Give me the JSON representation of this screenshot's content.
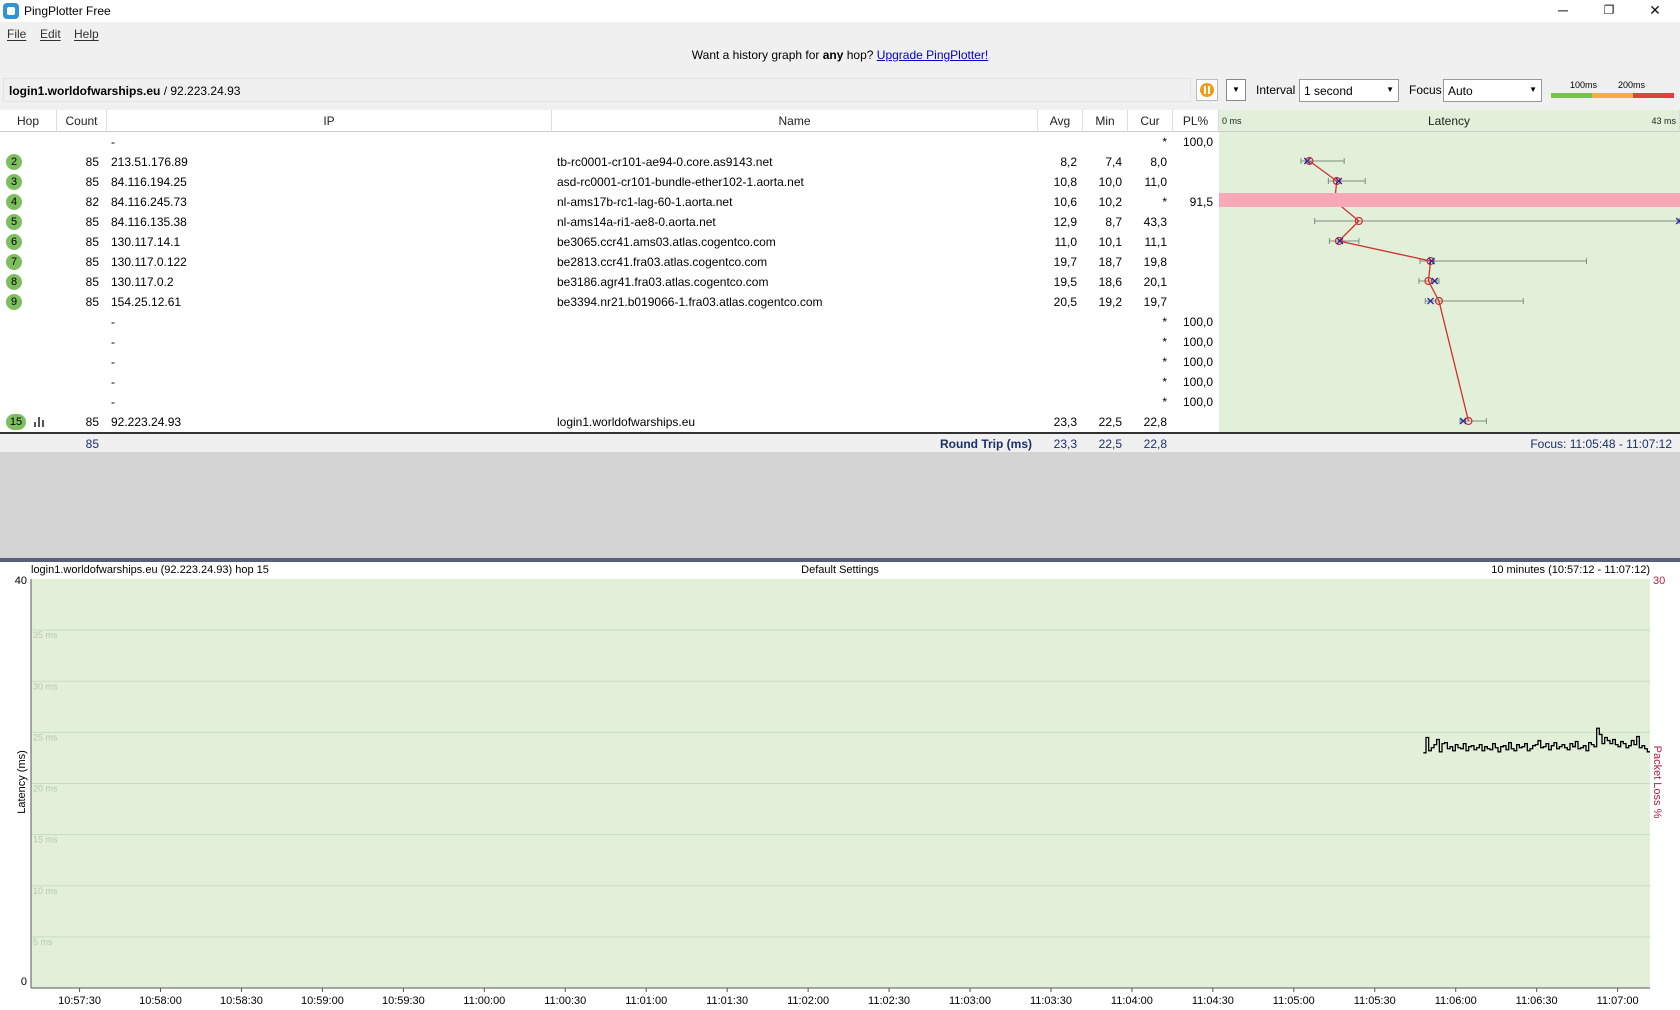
{
  "window": {
    "title": "PingPlotter Free",
    "minimize": "─",
    "maximize": "❐",
    "close": "✕"
  },
  "menu": [
    {
      "label": "File"
    },
    {
      "label": "Edit"
    },
    {
      "label": "Help"
    }
  ],
  "banner": {
    "prefix": "Want a history graph for ",
    "bold": "any",
    "middle": " hop? ",
    "link": "Upgrade PingPlotter!"
  },
  "target": {
    "host": "login1.worldofwarships.eu",
    "ip": " / 92.223.24.93"
  },
  "controls": {
    "interval_label": "Interval",
    "interval_value": "1 second",
    "focus_label": "Focus",
    "focus_value": "Auto",
    "scale_100": "100ms",
    "scale_200": "200ms"
  },
  "colors": {
    "good": "#78c050",
    "warn": "#f0b040",
    "bad": "#e04040",
    "lossRow": "#f7a8b8",
    "latencyBg": "#e2f0d9",
    "line": "#d03030"
  },
  "table": {
    "columns": [
      "Hop",
      "Count",
      "IP",
      "Name",
      "Avg",
      "Min",
      "Cur",
      "PL%",
      "Latency"
    ],
    "latency_min_label": "0 ms",
    "latency_max_label": "43 ms",
    "rows": [
      {
        "hop": "",
        "count": "",
        "ip": "-",
        "name": "",
        "avg": "",
        "min": "",
        "cur": "*",
        "pl": "100,0"
      },
      {
        "hop": "2",
        "count": "85",
        "ip": "213.51.176.89",
        "name": "tb-rc0001-cr101-ae94-0.core.as9143.net",
        "avg": "8,2",
        "min": "7,4",
        "cur": "8,0",
        "pl": ""
      },
      {
        "hop": "3",
        "count": "85",
        "ip": "84.116.194.25",
        "name": "asd-rc0001-cr101-bundle-ether102-1.aorta.net",
        "avg": "10,8",
        "min": "10,0",
        "cur": "11,0",
        "pl": ""
      },
      {
        "hop": "4",
        "count": "82",
        "ip": "84.116.245.73",
        "name": "nl-ams17b-rc1-lag-60-1.aorta.net",
        "avg": "10,6",
        "min": "10,2",
        "cur": "*",
        "pl": "91,5"
      },
      {
        "hop": "5",
        "count": "85",
        "ip": "84.116.135.38",
        "name": "nl-ams14a-ri1-ae8-0.aorta.net",
        "avg": "12,9",
        "min": "8,7",
        "cur": "43,3",
        "pl": ""
      },
      {
        "hop": "6",
        "count": "85",
        "ip": "130.117.14.1",
        "name": "be3065.ccr41.ams03.atlas.cogentco.com",
        "avg": "11,0",
        "min": "10,1",
        "cur": "11,1",
        "pl": ""
      },
      {
        "hop": "7",
        "count": "85",
        "ip": "130.117.0.122",
        "name": "be2813.ccr41.fra03.atlas.cogentco.com",
        "avg": "19,7",
        "min": "18,7",
        "cur": "19,8",
        "pl": ""
      },
      {
        "hop": "8",
        "count": "85",
        "ip": "130.117.0.2",
        "name": "be3186.agr41.fra03.atlas.cogentco.com",
        "avg": "19,5",
        "min": "18,6",
        "cur": "20,1",
        "pl": ""
      },
      {
        "hop": "9",
        "count": "85",
        "ip": "154.25.12.61",
        "name": "be3394.nr21.b019066-1.fra03.atlas.cogentco.com",
        "avg": "20,5",
        "min": "19,2",
        "cur": "19,7",
        "pl": ""
      },
      {
        "hop": "",
        "count": "",
        "ip": "-",
        "name": "",
        "avg": "",
        "min": "",
        "cur": "*",
        "pl": "100,0"
      },
      {
        "hop": "",
        "count": "",
        "ip": "-",
        "name": "",
        "avg": "",
        "min": "",
        "cur": "*",
        "pl": "100,0"
      },
      {
        "hop": "",
        "count": "",
        "ip": "-",
        "name": "",
        "avg": "",
        "min": "",
        "cur": "*",
        "pl": "100,0"
      },
      {
        "hop": "",
        "count": "",
        "ip": "-",
        "name": "",
        "avg": "",
        "min": "",
        "cur": "*",
        "pl": "100,0"
      },
      {
        "hop": "",
        "count": "",
        "ip": "-",
        "name": "",
        "avg": "",
        "min": "",
        "cur": "*",
        "pl": "100,0"
      },
      {
        "hop": "15",
        "count": "85",
        "ip": "92.223.24.93",
        "name": "login1.worldofwarships.eu",
        "avg": "23,3",
        "min": "22,5",
        "cur": "22,8",
        "pl": ""
      }
    ],
    "round_trip": {
      "count": "85",
      "label": "Round Trip (ms)",
      "avg": "23,3",
      "min": "22,5",
      "cur": "22,8",
      "focus": "Focus: 11:05:48 - 11:07:12"
    }
  },
  "latency_graph": {
    "range_ms": [
      0,
      43
    ],
    "points": [
      {
        "hop": "2",
        "avg": 8.2,
        "cur": 8.0,
        "min": 7.4,
        "max": 11.5,
        "rowIndex": 1
      },
      {
        "hop": "3",
        "avg": 10.8,
        "cur": 11.0,
        "min": 10.0,
        "max": 13.5,
        "rowIndex": 2
      },
      {
        "hop": "4",
        "avg": 10.6,
        "cur": null,
        "min": 10.2,
        "max": 10.8,
        "rowIndex": 3
      },
      {
        "hop": "5",
        "avg": 12.9,
        "cur": 43.3,
        "min": 8.7,
        "max": 43.3,
        "rowIndex": 4
      },
      {
        "hop": "6",
        "avg": 11.0,
        "cur": 11.1,
        "min": 10.1,
        "max": 12.9,
        "rowIndex": 5
      },
      {
        "hop": "7",
        "avg": 19.7,
        "cur": 19.8,
        "min": 18.7,
        "max": 34.5,
        "rowIndex": 6
      },
      {
        "hop": "8",
        "avg": 19.5,
        "cur": 20.1,
        "min": 18.6,
        "max": 20.5,
        "rowIndex": 7
      },
      {
        "hop": "9",
        "avg": 20.5,
        "cur": 19.7,
        "min": 19.2,
        "max": 28.5,
        "rowIndex": 8
      },
      {
        "hop": "15",
        "avg": 23.3,
        "cur": 22.8,
        "min": 22.5,
        "max": 25.0,
        "rowIndex": 14
      }
    ]
  },
  "history": {
    "left_title": "login1.worldofwarships.eu (92.223.24.93) hop 15",
    "center_title": "Default Settings",
    "right_title": "10 minutes (10:57:12 - 11:07:12)",
    "y_label": "Latency (ms)",
    "y2_label": "Packet Loss %",
    "y_top": "40",
    "y_bottom": "0",
    "y2_top": "30",
    "gridlines": [
      "35 ms",
      "30 ms",
      "25 ms",
      "20 ms",
      "15 ms",
      "10 ms",
      "5 ms"
    ],
    "x_ticks": [
      "10:57:30",
      "10:58:00",
      "10:58:30",
      "10:59:00",
      "10:59:30",
      "11:00:00",
      "11:00:30",
      "11:01:00",
      "11:01:30",
      "11:02:00",
      "11:02:30",
      "11:03:00",
      "11:03:30",
      "11:04:00",
      "11:04:30",
      "11:05:00",
      "11:05:30",
      "11:06:00",
      "11:06:30",
      "11:07:00"
    ]
  },
  "chart_data": {
    "type": "line",
    "title": "Default Settings",
    "xlabel": "",
    "ylabel": "Latency (ms)",
    "ylim": [
      0,
      40
    ],
    "x_range": [
      "10:57:12",
      "11:07:12"
    ],
    "series": [
      {
        "values_start": "11:05:48",
        "values_end": "11:07:12",
        "values": [
          23.0,
          24.5,
          23.2,
          23.5,
          23.8,
          24.3,
          23.1,
          23.9,
          24.0,
          23.4,
          23.6,
          23.2,
          23.8,
          23.5,
          23.4,
          23.9,
          23.2,
          23.6,
          23.7,
          23.3,
          23.5,
          23.8,
          23.2,
          23.6,
          23.4,
          23.3,
          23.9,
          23.5,
          23.1,
          23.6,
          23.7,
          23.3,
          24.0,
          23.4,
          23.2,
          23.8,
          23.5,
          23.6,
          23.9,
          23.2,
          23.4,
          23.7,
          23.8,
          24.2,
          23.5,
          23.6,
          23.9,
          23.3,
          23.7,
          24.0,
          23.4,
          23.6,
          23.8,
          23.5,
          23.3,
          23.9,
          23.6,
          24.1,
          23.4,
          23.5,
          23.7,
          23.2,
          24.0,
          23.8,
          23.6,
          25.4,
          24.8,
          23.9,
          24.5,
          24.2,
          23.9,
          24.3,
          23.8,
          23.6,
          24.1,
          23.9,
          23.5,
          23.7,
          24.2,
          23.8,
          24.6,
          23.5,
          23.7,
          23.4,
          23.1
        ]
      }
    ]
  }
}
